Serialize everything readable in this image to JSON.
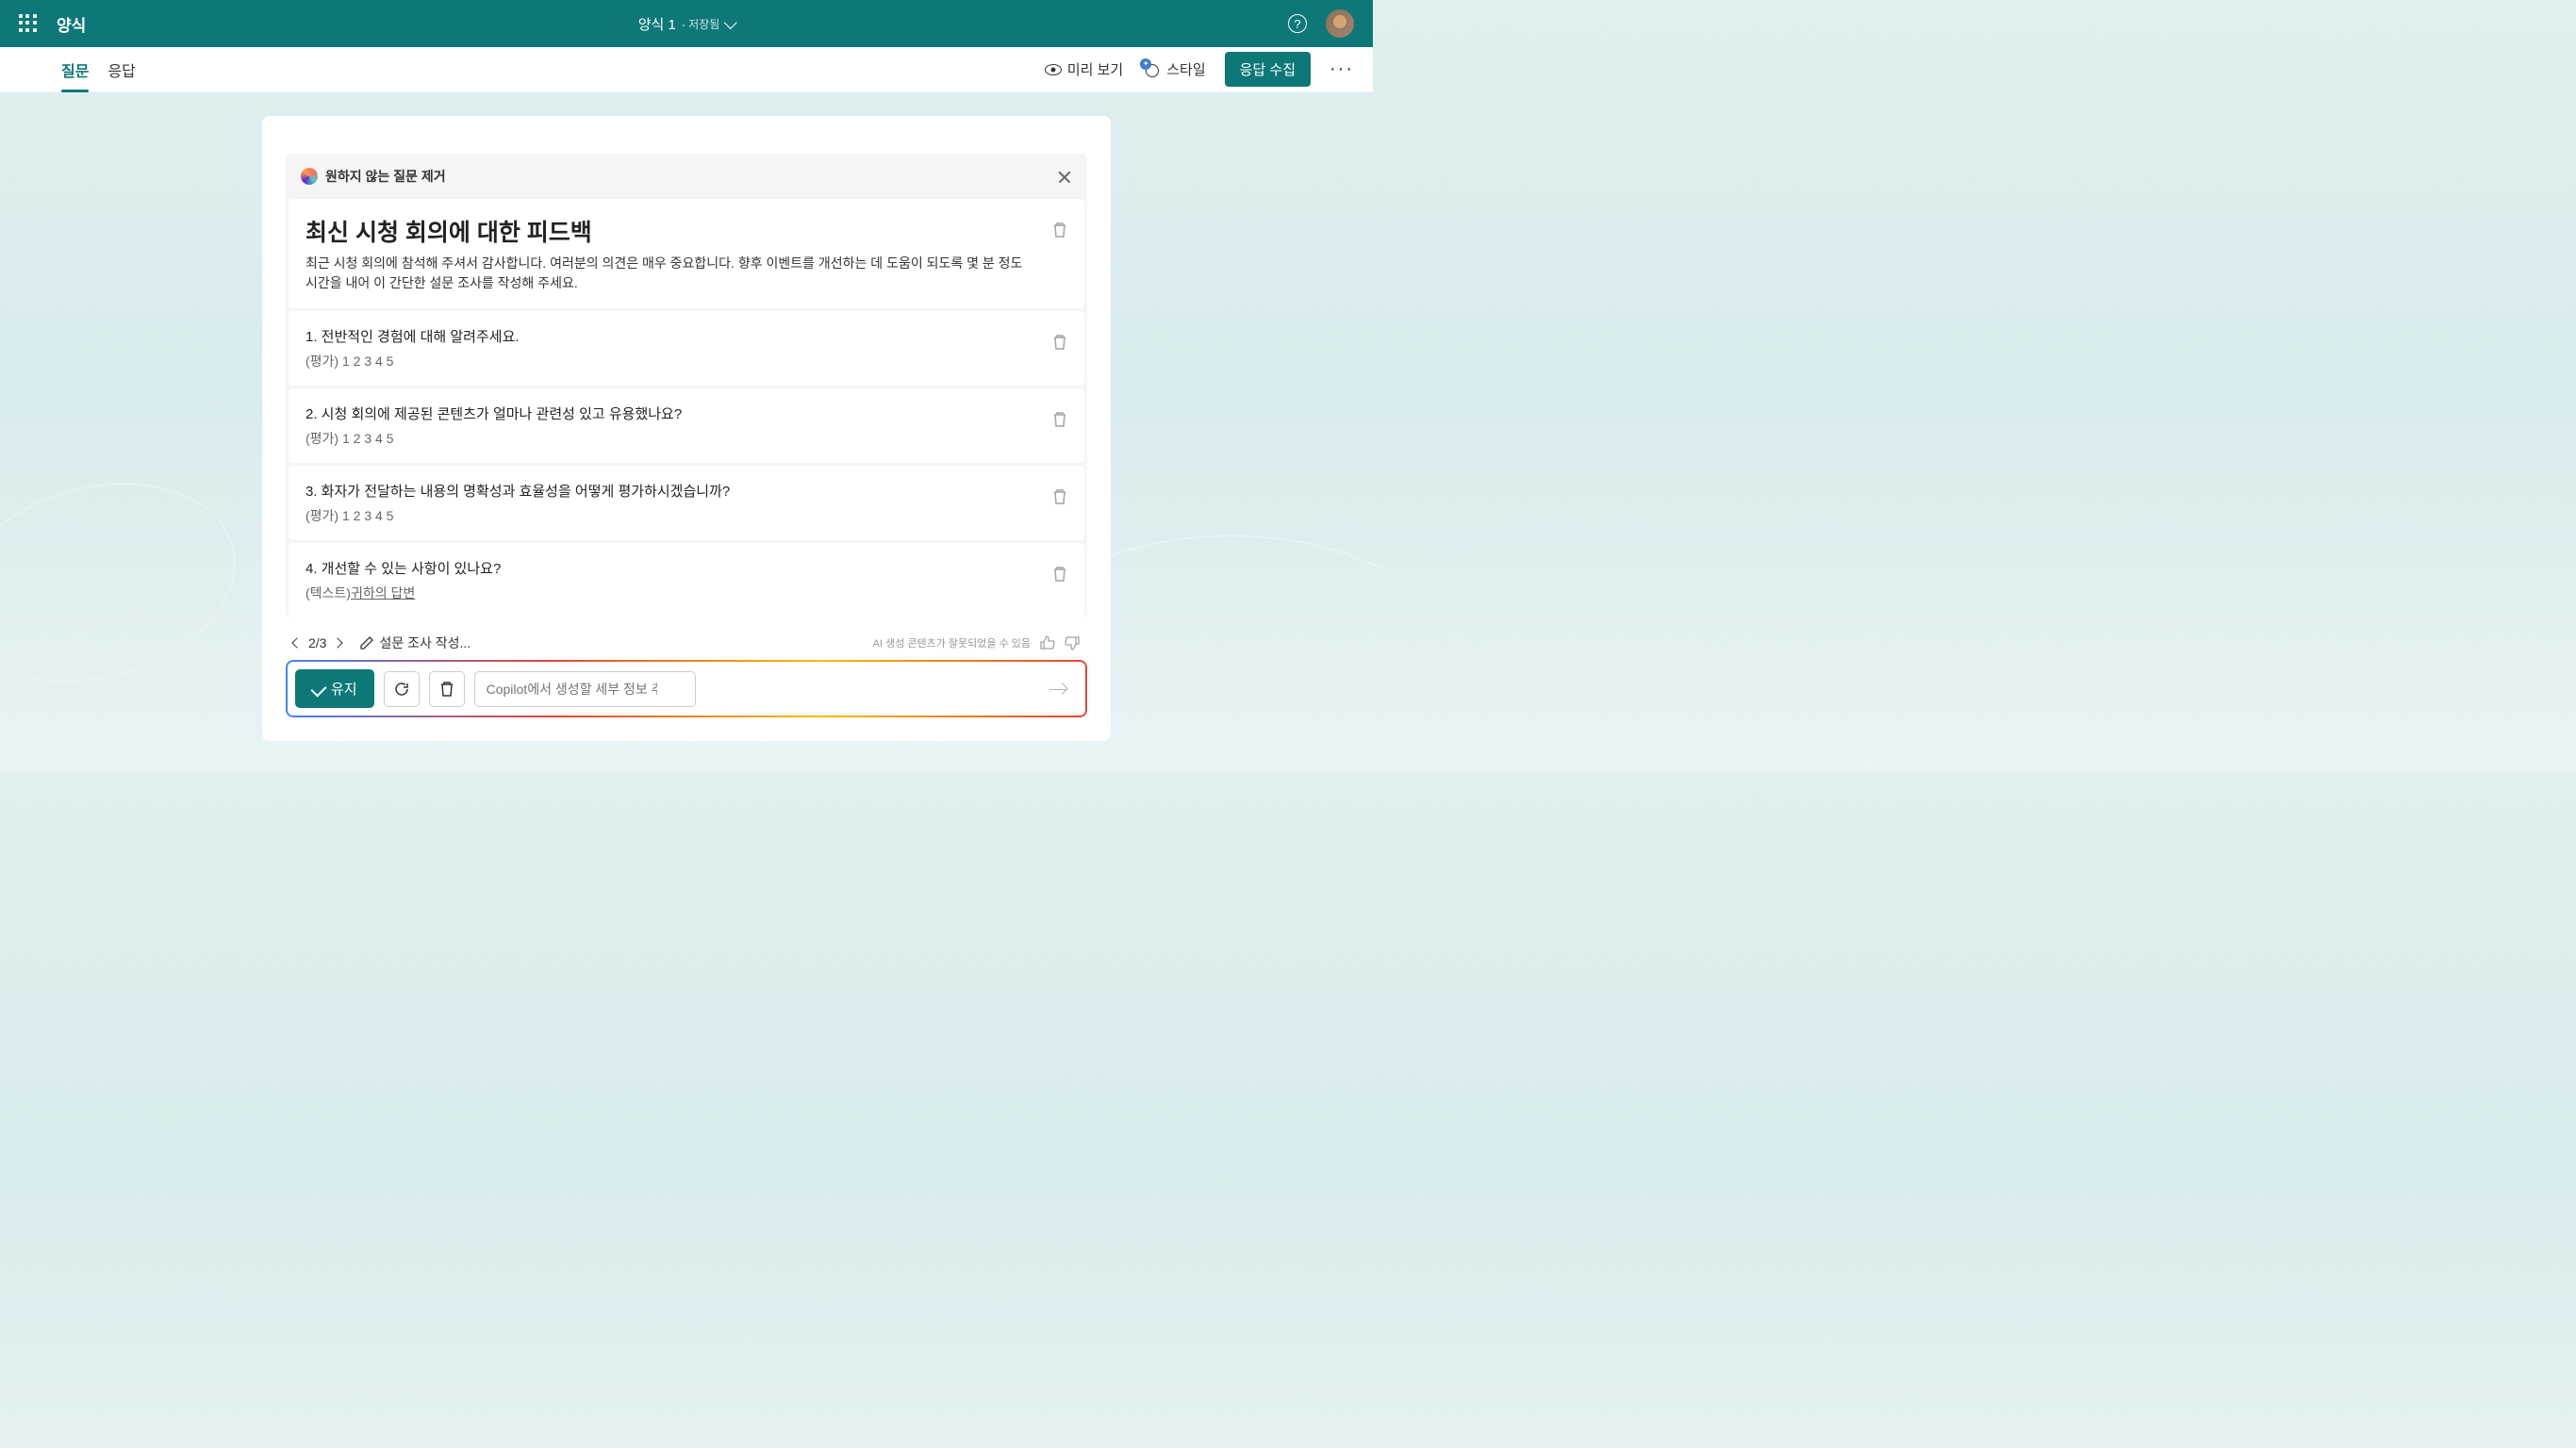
{
  "header": {
    "app_name": "양식",
    "form_title": "양식 1",
    "saved_label": "- 저장됨"
  },
  "tabs": {
    "questions": "질문",
    "responses": "응답"
  },
  "subbar": {
    "preview": "미리 보기",
    "style": "스타일",
    "collect": "응답 수집"
  },
  "panel": {
    "header_title": "원하지 않는 질문 제거",
    "form_title": "최신 시청 회의에 대한 피드백",
    "form_description": "최근 시청 회의에 참석해 주셔서 감사합니다. 여러분의 의견은 매우 중요합니다. 향후 이벤트를 개선하는 데 도움이 되도록 몇 분 정도 시간을 내어 이 간단한 설문 조사를 작성해 주세요."
  },
  "questions": [
    {
      "text": "1. 전반적인 경험에 대해 알려주세요.",
      "type": "(평가)  1   2   3   4   5"
    },
    {
      "text": "2. 시청 회의에 제공된 콘텐츠가 얼마나 관련성 있고 유용했나요?",
      "type": "(평가)  1   2   3   4   5"
    },
    {
      "text": "3. 화자가 전달하는 내용의 명확성과 효율성을 어떻게 평가하시겠습니까?",
      "type": "(평가)  1   2   3   4   5"
    },
    {
      "text": "4. 개선할 수 있는 사항이 있나요?",
      "type_prefix": "(텍스트)",
      "type_answer": "귀하의 답변"
    }
  ],
  "footer": {
    "page": "2/3",
    "edit_survey": "설문 조사 작성...",
    "ai_disclaimer": "AI 생성 콘텐츠가 잘못되었을 수 있음",
    "keep_label": "유지",
    "copilot_placeholder": "Copilot에서 생성할 세부 정보 추가"
  }
}
